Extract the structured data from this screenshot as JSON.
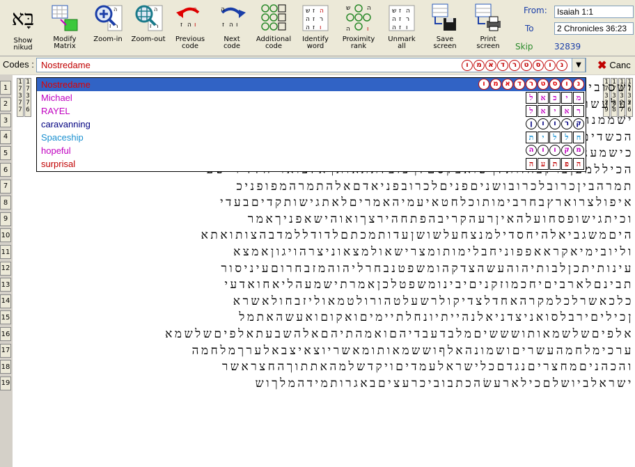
{
  "toolbar": {
    "buttons": [
      {
        "name": "logo-button",
        "label": ""
      },
      {
        "name": "modify-matrix-button",
        "label": "Modify\nMatrix"
      },
      {
        "name": "zoom-in-button",
        "label": "Zoom-in"
      },
      {
        "name": "zoom-out-button",
        "label": "Zoom-out"
      },
      {
        "name": "previous-code-button",
        "label": "Previous\ncode"
      },
      {
        "name": "next-code-button",
        "label": "Next\ncode"
      },
      {
        "name": "additional-code-button",
        "label": "Additional\ncode"
      },
      {
        "name": "identify-word-button",
        "label": "Identify\nword"
      },
      {
        "name": "proximity-rank-button",
        "label": "Proximity\nrank"
      },
      {
        "name": "unmark-all-button",
        "label": "Unmark\nall"
      },
      {
        "name": "save-screen-button",
        "label": "Save\nscreen"
      },
      {
        "name": "print-screen-button",
        "label": "Print\nscreen"
      }
    ],
    "show_nikud": "Show\nnikud",
    "logo_text": "בָּא"
  },
  "range": {
    "from_label": "From:",
    "to_label": "To",
    "from_value": "Isaiah 1:1",
    "to_value": "2 Chronicles 36:23",
    "skip_label": "Skip",
    "skip_value": "32839"
  },
  "codes": {
    "label": "Codes :",
    "value": "Nostredame",
    "value_hebrew": [
      "נ",
      "ו",
      "ס",
      "ט",
      "ר",
      "ד",
      "א",
      "מ",
      "ו"
    ],
    "cancel_label": "Canc",
    "cancel_icon": "x-icon"
  },
  "dropdown": {
    "items": [
      {
        "label": "Nostredame",
        "color": "#e00000",
        "selected": true,
        "codes": [
          "נ",
          "ו",
          "ס",
          "ט",
          "ר",
          "ד",
          "א",
          "מ",
          "ו"
        ]
      },
      {
        "label": "Michael",
        "color": "#c000c0",
        "selected": false,
        "codes": [
          "מ",
          "י",
          "כ",
          "א",
          "ל"
        ]
      },
      {
        "label": "RAYEL",
        "color": "#c000c0",
        "selected": false,
        "codes": [
          "ר",
          "א",
          "י",
          "א",
          "ל"
        ]
      },
      {
        "label": "caravanning",
        "color": "#000080",
        "selected": false,
        "codes": [
          "ק",
          "ר",
          "ו",
          "ו",
          "ן"
        ]
      },
      {
        "label": "Spaceship",
        "color": "#1a90d0",
        "selected": false,
        "codes": [
          "ח",
          "ל",
          "ל",
          "י",
          "ת"
        ]
      },
      {
        "label": "hopeful",
        "color": "#c000c0",
        "selected": false,
        "codes": [
          "מ",
          "ק",
          "ו",
          "ו",
          "ה"
        ]
      },
      {
        "label": "surprisal",
        "color": "#c00000",
        "selected": false,
        "codes": [
          "ה",
          "פ",
          "ת",
          "ע",
          "ה"
        ]
      }
    ]
  },
  "rows": [
    {
      "num": "1",
      "text": "ושׁסוביניהבשמשבגהזחבשובענירנוירוגהבשבואהוארירוםחלשבענחלוריוםמ"
    },
    {
      "num": "2",
      "text": "יעלעשרשלמהבדבריהמלדששמחהוראותיעלואקשמעתינשוידבריוםמ"
    },
    {
      "num": "3",
      "text": "ישׁממנהשםמשושילמהבסדרעונותיהאלהשנמויחלשעלהיבעיהעכשמריינלאכמ"
    },
    {
      "num": "4",
      "text": "הכשדיםובידנבוכדראצרמלךבבלולכדהובאוהכשדיםהנלחמיםעלהעי"
    },
    {
      "num": "5",
      "text": "כישמענוחרפהכסתהכלמהפנינוכיבאוזריםעלמקדשיביתיהוהלכןהנ"
    },
    {
      "num": "6",
      "text": "הכיללמעןברקבחזותלךשואבקסםלךכזבלתתאותךאלצואריחלליר שעי"
    },
    {
      "num": "7",
      "text": "תמרהביןכרובלכרובושניםפניםלכרובפניאדםאלהתמרהמפופניכ"
    },
    {
      "num": "8",
      "text": "איפולצרוארץבחרבימותוכלחטאיעמיהאמריםלאתגישותקדיםבעדי"
    },
    {
      "num": "9",
      "text": "וכיתגישופסחועלהאיןרעהקריבהפתחהירצךואוהישאפניךאמר"
    },
    {
      "num": "10",
      "text": "היםמשגביאלהיחסדילמנצחעלשושןעדותמכתםלדודללמדבהצותואתא"
    },
    {
      "num": "11",
      "text": "וליובימיאקראאפפוניחבלימותומצרישאולמצאוניצרהויגוןאמצא"
    },
    {
      "num": "12",
      "text": "עינותיתכןלבותיהוהעשהצדקהומשפטנבחרליהוהמזבחרוםעיניסור"
    },
    {
      "num": "13",
      "text": "תבינםלארביםיחכמוזקניםיבינומשפטלכןאמרתישמעהליאחואדעי"
    },
    {
      "num": "14",
      "text": "כלכאשרלכלמקרהאחדלצדיקולרשעלטהורולטמאוליזבחולאשרא"
    },
    {
      "num": "15",
      "text": "ןכיליםירבלסואניצדניאלנהייתיונחלתיימיםואקוםואעשהאתמל"
    },
    {
      "num": "16",
      "text": "אלפיםשלשמאותושששיםמלבדעבדיהםואמהתיהםאלהשבעתאלפיםשלשמא"
    },
    {
      "num": "17",
      "text": "ערכימלחמהעשריםושמונהאלףוששמאותומאשריוצאיצבאלערךמלחמה"
    },
    {
      "num": "18",
      "text": "והכהניםמחצריםנגדםכלישראלעמדיםויקדשלמהאתתוךהחצראשר"
    },
    {
      "num": "19",
      "text": "ישראלביושלםכילארעשׂהכתבוביכרעציםבאגרותמידהמלךוש"
    }
  ],
  "header_cols": {
    "left": [
      [
        "1",
        "7",
        "3",
        "7",
        "7"
      ],
      [
        "1",
        "7",
        "3",
        "7",
        "6"
      ]
    ],
    "right": [
      [
        "1",
        "7",
        "3",
        "2",
        "9"
      ],
      [
        "1",
        "7",
        "3",
        "2",
        "8"
      ],
      [
        "1",
        "7",
        "3",
        "2",
        "7"
      ],
      [
        "1",
        "7",
        "3",
        "2",
        "6"
      ]
    ]
  }
}
